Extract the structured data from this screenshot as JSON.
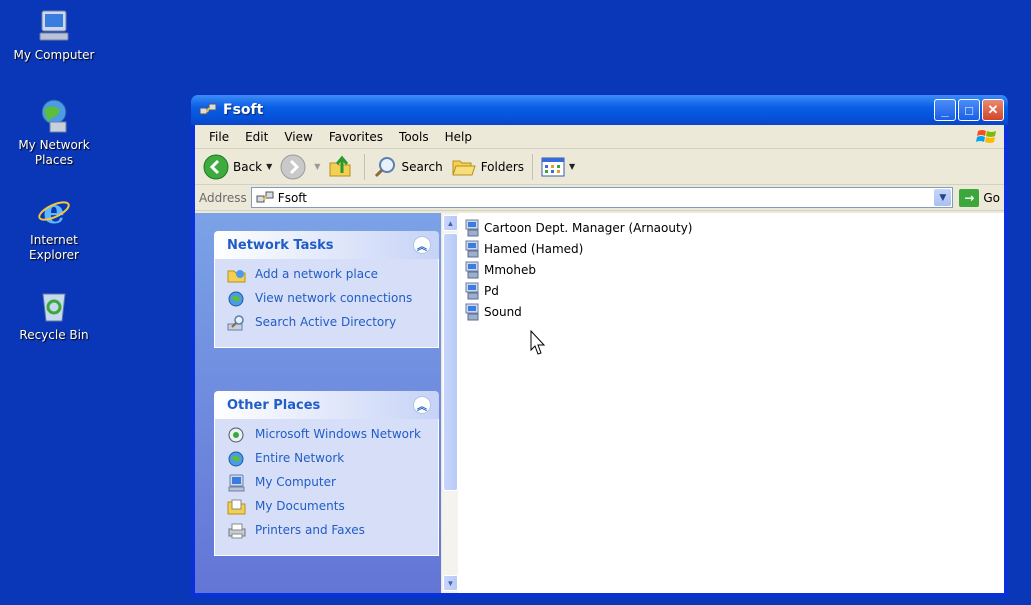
{
  "desktop": {
    "icons": [
      {
        "label": "My Computer"
      },
      {
        "label": "My Network Places"
      },
      {
        "label": "Internet Explorer"
      },
      {
        "label": "Recycle Bin"
      }
    ]
  },
  "window": {
    "title": "Fsoft",
    "menu": [
      "File",
      "Edit",
      "View",
      "Favorites",
      "Tools",
      "Help"
    ],
    "toolbar": {
      "back": "Back",
      "search": "Search",
      "folders": "Folders"
    },
    "address": {
      "label": "Address",
      "value": "Fsoft",
      "go": "Go"
    }
  },
  "network_tasks": {
    "title": "Network Tasks",
    "items": [
      {
        "label": "Add a network place",
        "icon": "add-network-place-icon"
      },
      {
        "label": "View network connections",
        "icon": "network-connections-icon"
      },
      {
        "label": "Search Active Directory",
        "icon": "search-directory-icon"
      }
    ]
  },
  "other_places": {
    "title": "Other Places",
    "items": [
      {
        "label": "Microsoft Windows Network",
        "icon": "windows-network-icon"
      },
      {
        "label": "Entire Network",
        "icon": "entire-network-icon"
      },
      {
        "label": "My Computer",
        "icon": "my-computer-icon"
      },
      {
        "label": "My Documents",
        "icon": "my-documents-icon"
      },
      {
        "label": "Printers and Faxes",
        "icon": "printers-icon"
      }
    ]
  },
  "files": [
    {
      "name": "Cartoon Dept. Manager (Arnaouty)"
    },
    {
      "name": "Hamed (Hamed)"
    },
    {
      "name": "Mmoheb"
    },
    {
      "name": "Pd"
    },
    {
      "name": "Sound"
    }
  ],
  "colors": {
    "desktop": "#0a36b8",
    "title_bar": "#0550d8",
    "task_link": "#215dc6",
    "chrome": "#ece9d8"
  }
}
